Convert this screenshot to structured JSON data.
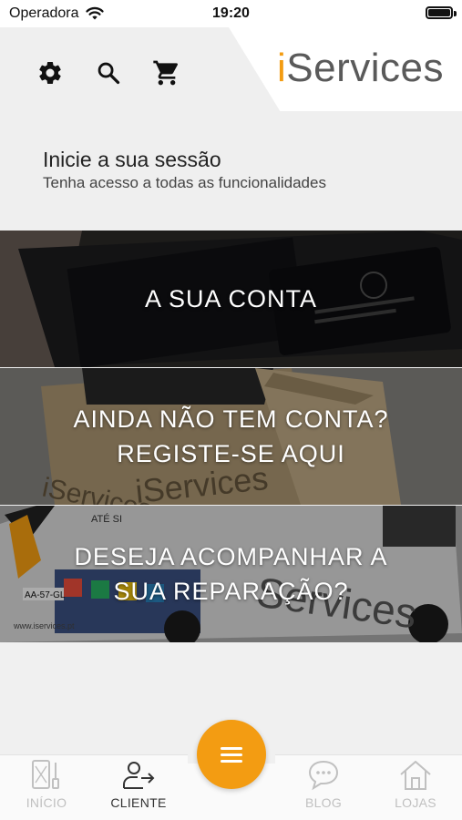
{
  "status_bar": {
    "carrier": "Operadora",
    "time": "19:20"
  },
  "header": {
    "logo_i": "i",
    "logo_rest": "Services"
  },
  "session": {
    "title": "Inicie a sua sessão",
    "subtitle": "Tenha acesso a todas as funcionalidades"
  },
  "tiles": [
    {
      "label": "A SUA CONTA"
    },
    {
      "label_line1": "AINDA NÃO TEM CONTA?",
      "label_line2": "REGISTE-SE AQUI"
    },
    {
      "label_line1": "DESEJA ACOMPANHAR A",
      "label_line2": "SUA REPARAÇÃO?"
    }
  ],
  "tile_photo_text": {
    "box_brand": "iServices",
    "van_text": "ATÉ SI",
    "van_brand": "Services",
    "van_plate": "AA-57-GL",
    "van_url": "www.iservices.pt"
  },
  "bottom_nav": {
    "items": [
      {
        "label": "INÍCIO",
        "icon": "phone-repair-icon"
      },
      {
        "label": "CLIENTE",
        "icon": "user-login-icon"
      },
      {
        "label": "BLOG",
        "icon": "chat-bubble-icon"
      },
      {
        "label": "LOJAS",
        "icon": "home-icon"
      }
    ],
    "fab_icon": "menu-icon"
  },
  "colors": {
    "accent": "#f39c12",
    "logo_gray": "#5a5a5a"
  }
}
